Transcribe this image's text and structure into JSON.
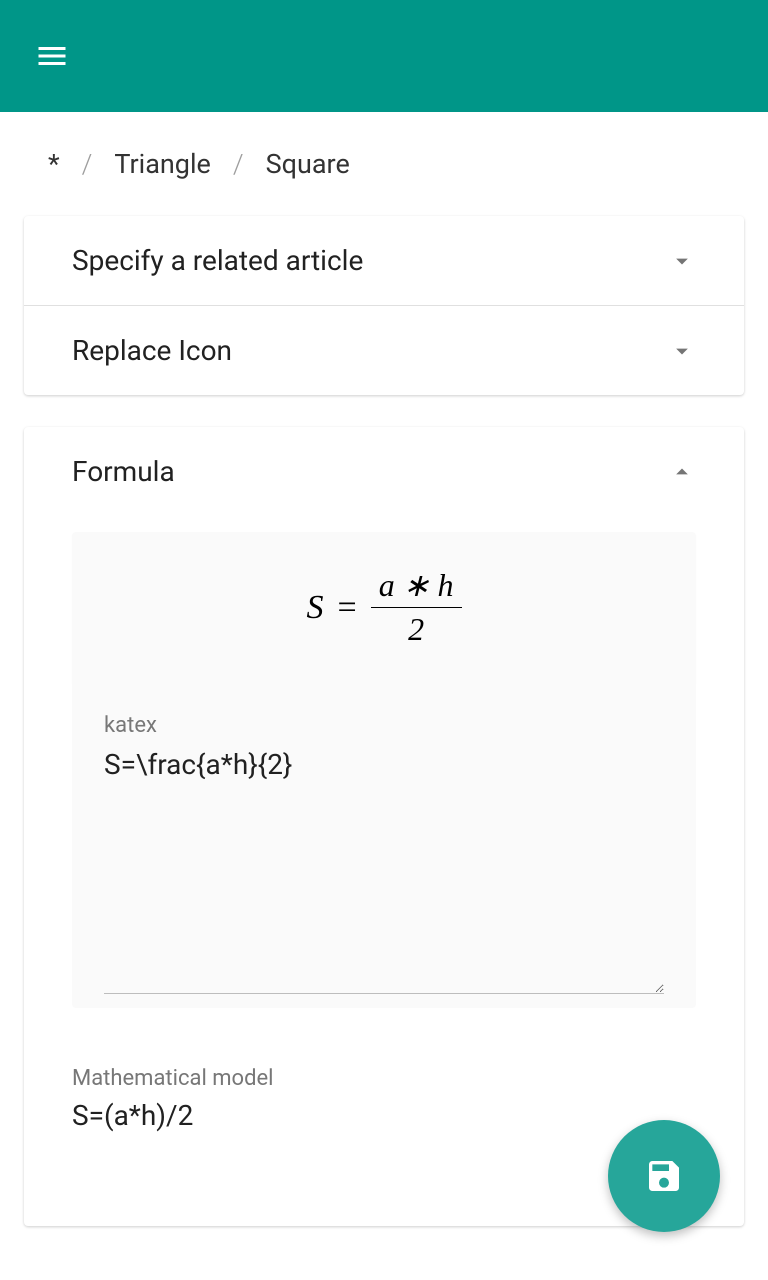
{
  "breadcrumb": {
    "root": "*",
    "items": [
      "Triangle",
      "Square"
    ]
  },
  "panels": {
    "related": {
      "title": "Specify a related article"
    },
    "icon": {
      "title": "Replace Icon"
    },
    "formula": {
      "title": "Formula"
    }
  },
  "formula": {
    "preview_left": "S",
    "preview_num": "a ∗ h",
    "preview_den": "2",
    "katex_label": "katex",
    "katex_value": "S=\\frac{a*h}{2}",
    "model_label": "Mathematical model",
    "model_value": "S=(a*h)/2"
  }
}
